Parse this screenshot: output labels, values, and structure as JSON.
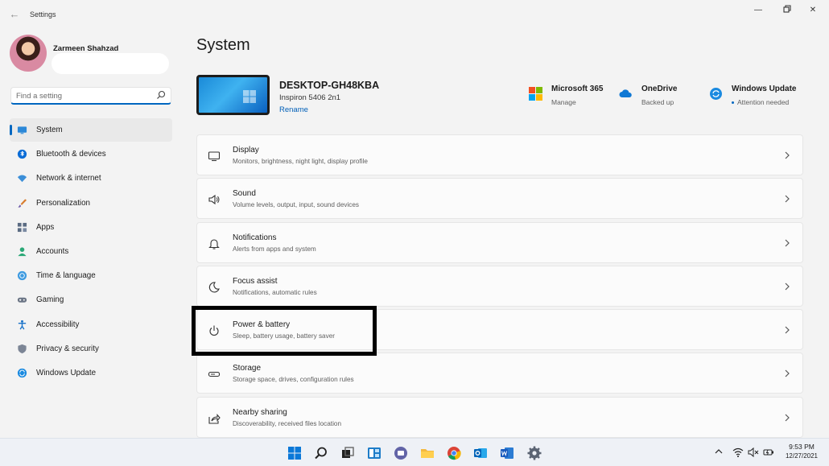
{
  "window": {
    "title": "Settings",
    "back_icon": "back-arrow-icon",
    "controls": [
      "minimize-icon",
      "restore-icon",
      "close-icon"
    ]
  },
  "profile": {
    "name": "Zarmeen Shahzad"
  },
  "search": {
    "placeholder": "Find a setting"
  },
  "nav": {
    "items": [
      {
        "label": "System",
        "icon": "monitor-icon",
        "selected": true
      },
      {
        "label": "Bluetooth & devices",
        "icon": "bluetooth-icon"
      },
      {
        "label": "Network & internet",
        "icon": "wifi-icon"
      },
      {
        "label": "Personalization",
        "icon": "brush-icon"
      },
      {
        "label": "Apps",
        "icon": "apps-icon"
      },
      {
        "label": "Accounts",
        "icon": "person-icon"
      },
      {
        "label": "Time & language",
        "icon": "globe-clock-icon"
      },
      {
        "label": "Gaming",
        "icon": "gamepad-icon"
      },
      {
        "label": "Accessibility",
        "icon": "accessibility-icon"
      },
      {
        "label": "Privacy & security",
        "icon": "shield-icon"
      },
      {
        "label": "Windows Update",
        "icon": "update-icon"
      }
    ]
  },
  "page": {
    "title": "System"
  },
  "device": {
    "name": "DESKTOP-GH48KBA",
    "model": "Inspiron 5406 2n1",
    "rename_label": "Rename"
  },
  "quick_links": [
    {
      "title": "Microsoft 365",
      "subtitle": "Manage",
      "icon": "microsoft-365-icon"
    },
    {
      "title": "OneDrive",
      "subtitle": "Backed up",
      "icon": "onedrive-cloud-icon"
    },
    {
      "title": "Windows Update",
      "subtitle": "Attention needed",
      "icon": "windows-update-icon"
    }
  ],
  "settings": [
    {
      "title": "Display",
      "subtitle": "Monitors, brightness, night light, display profile",
      "icon": "display-icon"
    },
    {
      "title": "Sound",
      "subtitle": "Volume levels, output, input, sound devices",
      "icon": "speaker-icon"
    },
    {
      "title": "Notifications",
      "subtitle": "Alerts from apps and system",
      "icon": "bell-icon"
    },
    {
      "title": "Focus assist",
      "subtitle": "Notifications, automatic rules",
      "icon": "moon-icon"
    },
    {
      "title": "Power & battery",
      "subtitle": "Sleep, battery usage, battery saver",
      "icon": "power-icon"
    },
    {
      "title": "Storage",
      "subtitle": "Storage space, drives, configuration rules",
      "icon": "storage-icon"
    },
    {
      "title": "Nearby sharing",
      "subtitle": "Discoverability, received files location",
      "icon": "share-icon"
    }
  ],
  "taskbar": {
    "apps": [
      "start-icon",
      "search-icon",
      "task-view-icon",
      "widgets-icon",
      "teams-chat-icon",
      "file-explorer-icon",
      "chrome-icon",
      "outlook-icon",
      "word-icon",
      "settings-gear-icon"
    ],
    "tray": [
      "chevron-up-icon",
      "wifi-icon",
      "volume-mute-icon",
      "battery-icon"
    ],
    "time": "9:53 PM",
    "date": "12/27/2021"
  },
  "colors": {
    "accent": "#0067c0",
    "background": "#f3f3f3",
    "card": "#fbfbfb"
  }
}
